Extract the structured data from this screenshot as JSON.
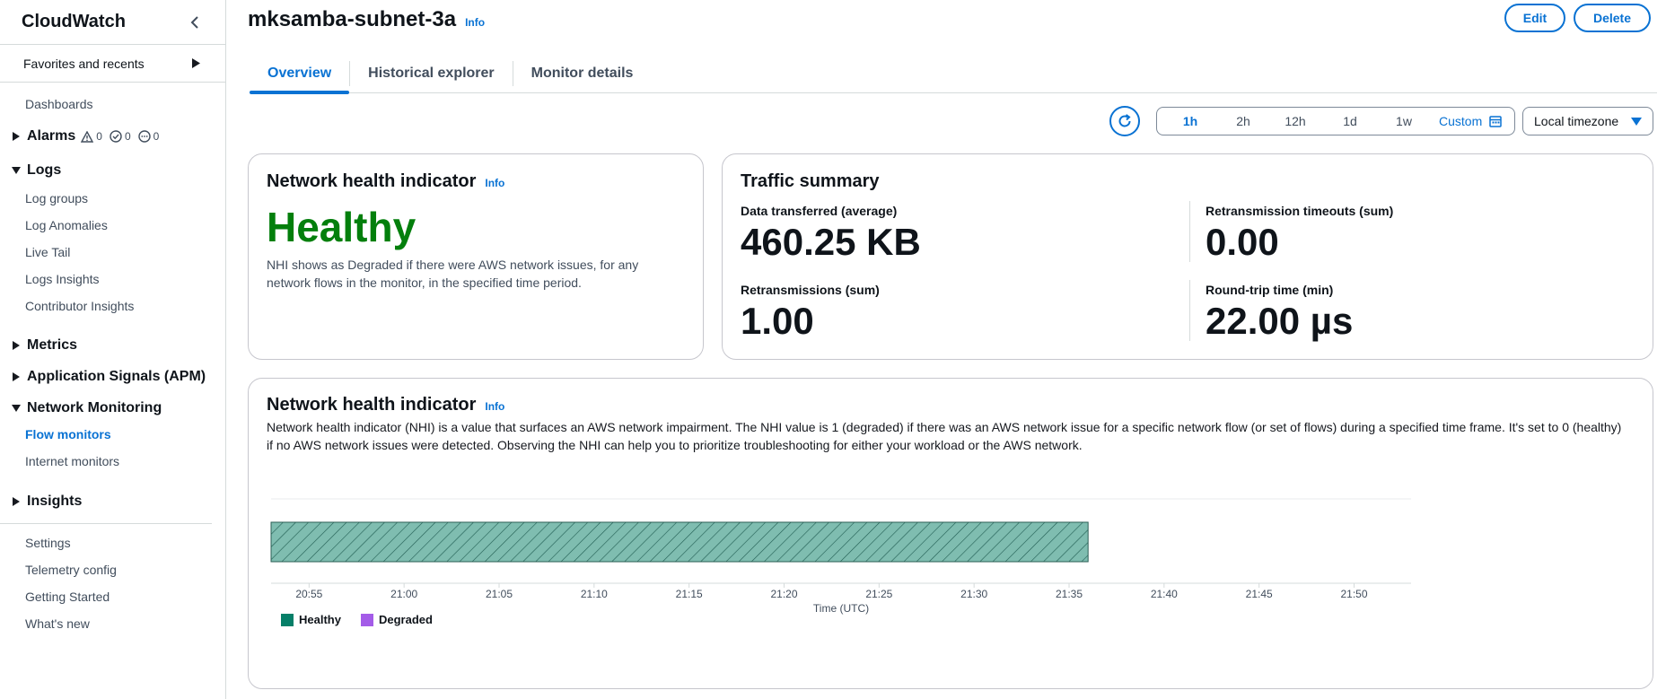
{
  "sidebar": {
    "title": "CloudWatch",
    "favorites": "Favorites and recents",
    "dashboards": "Dashboards",
    "alarms": {
      "label": "Alarms",
      "alarm_count": "0",
      "ok_count": "0",
      "insufficient_count": "0"
    },
    "logs": {
      "label": "Logs",
      "items": [
        "Log groups",
        "Log Anomalies",
        "Live Tail",
        "Logs Insights",
        "Contributor Insights"
      ]
    },
    "metrics": "Metrics",
    "app_signals": "Application Signals (APM)",
    "network": {
      "label": "Network Monitoring",
      "items": [
        "Flow monitors",
        "Internet monitors"
      ]
    },
    "insights": "Insights",
    "bottom": [
      "Settings",
      "Telemetry config",
      "Getting Started",
      "What's new"
    ]
  },
  "header": {
    "title": "mksamba-subnet-3a",
    "info": "Info",
    "edit": "Edit",
    "delete": "Delete"
  },
  "tabs": [
    "Overview",
    "Historical explorer",
    "Monitor details"
  ],
  "time_range": {
    "options": [
      "1h",
      "2h",
      "12h",
      "1d",
      "1w",
      "Custom"
    ],
    "selected": "1h",
    "timezone": "Local timezone"
  },
  "nhi_card": {
    "title": "Network health indicator",
    "info": "Info",
    "status": "Healthy",
    "description": "NHI shows as Degraded if there were AWS network issues, for any network flows in the monitor, in the specified time period."
  },
  "traffic": {
    "title": "Traffic summary",
    "data_transferred_label": "Data transferred (average)",
    "data_transferred_value": "460.25 KB",
    "retrans_timeouts_label": "Retransmission timeouts (sum)",
    "retrans_timeouts_value": "0.00",
    "retransmissions_label": "Retransmissions (sum)",
    "retransmissions_value": "1.00",
    "rtt_label": "Round-trip time (min)",
    "rtt_value": "22.00 µs"
  },
  "nhi_chart": {
    "title": "Network health indicator",
    "info": "Info",
    "description": "Network health indicator (NHI) is a value that surfaces an AWS network impairment. The NHI value is 1 (degraded) if there was an AWS network issue for a specific network flow (or set of flows) during a specified time frame. It's set to 0 (healthy) if no AWS network issues were detected. Observing the NHI can help you to prioritize troubleshooting for either your workload or the AWS network."
  },
  "chart_data": {
    "type": "bar",
    "x_ticks": [
      "20:55",
      "21:00",
      "21:05",
      "21:10",
      "21:15",
      "21:20",
      "21:25",
      "21:30",
      "21:35",
      "21:40",
      "21:45",
      "21:50"
    ],
    "xlabel": "Time (UTC)",
    "xlim": [
      "20:53",
      "21:53"
    ],
    "series": [
      {
        "name": "Healthy",
        "color": "#067f68",
        "segments": [
          {
            "start": "20:53",
            "end": "21:36"
          }
        ]
      },
      {
        "name": "Degraded",
        "color": "#a45ce8",
        "segments": []
      }
    ],
    "legend_position": "bottom-left"
  },
  "colors": {
    "accent": "#0972d3",
    "healthy": "#037f0c"
  }
}
